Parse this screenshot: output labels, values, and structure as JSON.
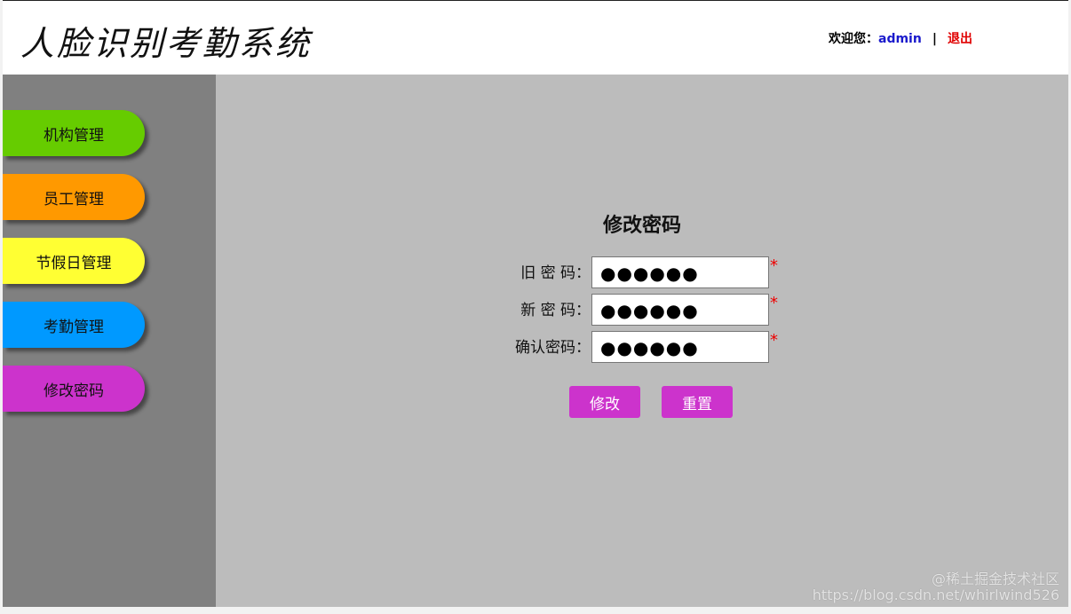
{
  "header": {
    "title": "人脸识别考勤系统",
    "welcome_label": "欢迎您：",
    "username": "admin",
    "separator": "|",
    "logout_label": "退出"
  },
  "sidebar": {
    "items": [
      {
        "label": "机构管理",
        "color": "#66cc00"
      },
      {
        "label": "员工管理",
        "color": "#ff9900"
      },
      {
        "label": "节假日管理",
        "color": "#ffff33"
      },
      {
        "label": "考勤管理",
        "color": "#0099ff"
      },
      {
        "label": "修改密码",
        "color": "#cc33cc"
      }
    ]
  },
  "form": {
    "title": "修改密码",
    "fields": [
      {
        "label": "旧 密 码：",
        "value": "●●●●●●",
        "required_mark": "*"
      },
      {
        "label": "新 密 码：",
        "value": "●●●●●●",
        "required_mark": "*"
      },
      {
        "label": "确认密码：",
        "value": "●●●●●●",
        "required_mark": "*"
      }
    ],
    "submit_label": "修改",
    "reset_label": "重置"
  },
  "watermark": {
    "line1": "@稀土掘金技术社区",
    "line2": "https://blog.csdn.net/whirlwind526"
  },
  "colors": {
    "sidebar_bg": "#808080",
    "main_bg": "#bcbcbc",
    "button_bg": "#cc33cc",
    "username": "#1a1acc",
    "logout": "#e00000"
  }
}
